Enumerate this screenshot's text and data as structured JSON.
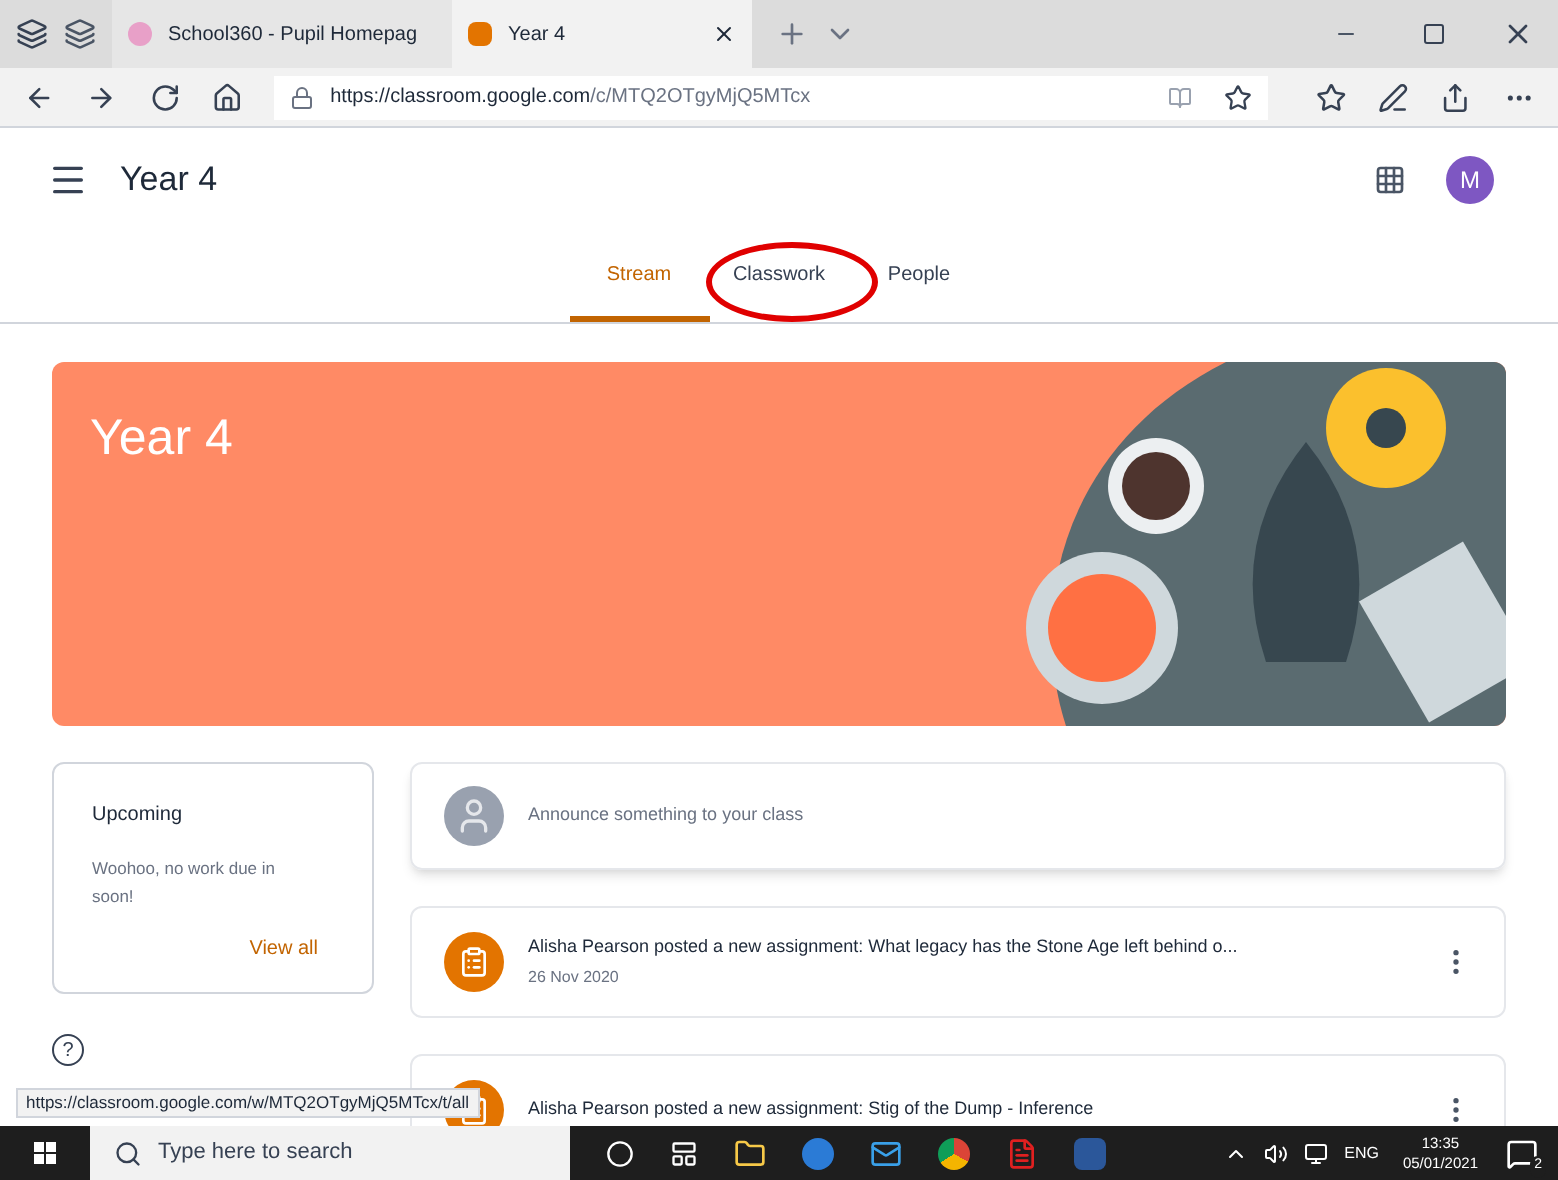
{
  "browser": {
    "tabs": [
      {
        "title": "School360 - Pupil Homepag",
        "selected": false
      },
      {
        "title": "Year 4",
        "selected": true
      }
    ],
    "url_host": "https://classroom.google.com",
    "url_path": "/c/MTQ2OTgyMjQ5MTcx"
  },
  "header": {
    "title": "Year 4",
    "avatar": "M"
  },
  "class_tabs": [
    {
      "label": "Stream",
      "selected": true,
      "circled": false
    },
    {
      "label": "Classwork",
      "selected": false,
      "circled": true
    },
    {
      "label": "People",
      "selected": false,
      "circled": false
    }
  ],
  "banner": {
    "title": "Year 4"
  },
  "upcoming": {
    "title": "Upcoming",
    "text": "Woohoo, no work due in soon!",
    "link": "View all"
  },
  "announce": {
    "placeholder": "Announce something to your class"
  },
  "posts": [
    {
      "text": "Alisha Pearson posted a new assignment: What legacy has the Stone Age left behind o...",
      "date": "26 Nov 2020"
    },
    {
      "text": "Alisha Pearson posted a new assignment: Stig of the Dump - Inference"
    }
  ],
  "help": "?",
  "status_url": "https://classroom.google.com/w/MTQ2OTgyMjQ5MTcx/t/all",
  "taskbar": {
    "search": "Type here to search",
    "lang": "ENG",
    "time": "13:35",
    "date": "05/01/2021",
    "notifications": "2"
  }
}
